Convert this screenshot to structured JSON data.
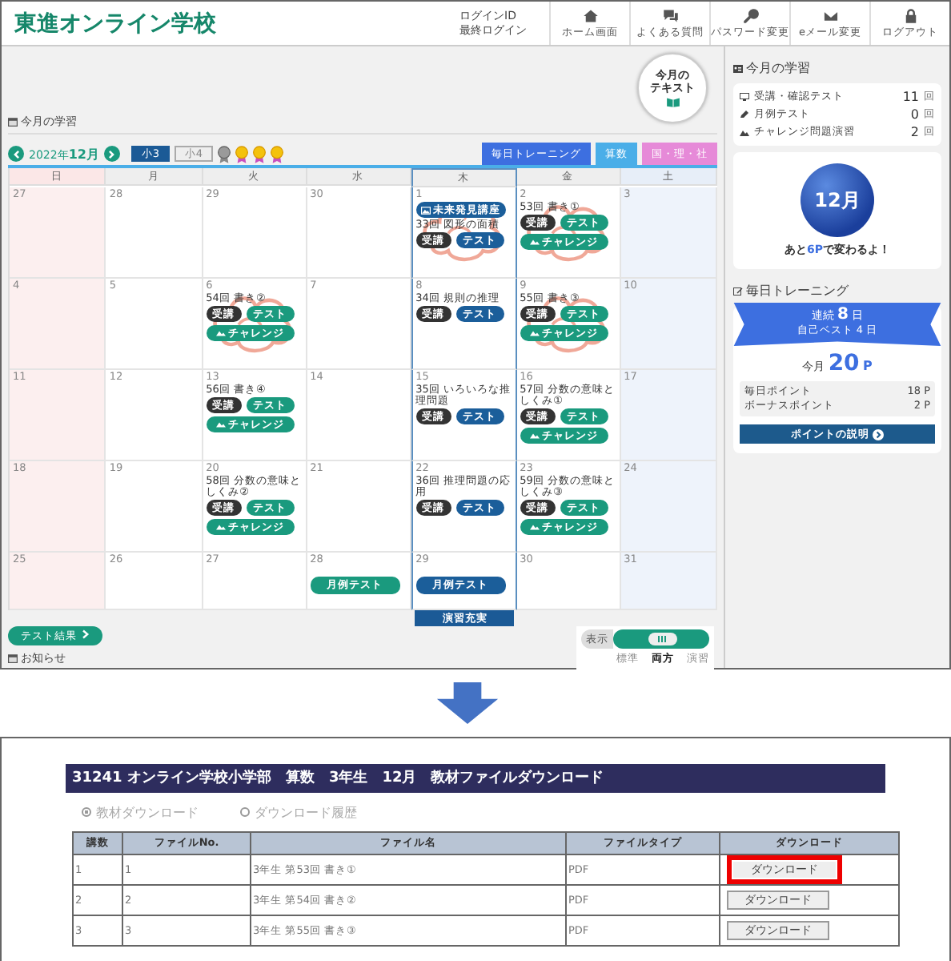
{
  "header": {
    "logo": "東進オンライン学校",
    "login_id_label": "ログインID",
    "last_login_label": "最終ログイン",
    "nav": [
      {
        "kind": "home",
        "label": "ホーム画面"
      },
      {
        "kind": "chat",
        "label": "よくある質問"
      },
      {
        "kind": "key",
        "label": "パスワード変更"
      },
      {
        "kind": "mail",
        "label": "eメール変更"
      },
      {
        "kind": "lock",
        "label": "ログアウト"
      }
    ]
  },
  "text_badge": {
    "lines": [
      "今月の",
      "テキスト"
    ]
  },
  "section_title": "今月の学習",
  "toolbar": {
    "year": "2022年",
    "month": "12月",
    "grades": [
      {
        "label": "小3",
        "selected": true
      },
      {
        "label": "小4",
        "selected": false
      }
    ],
    "medals": [
      {
        "earned": false
      },
      {
        "earned": true
      },
      {
        "earned": true
      },
      {
        "earned": true
      }
    ],
    "tabs": [
      {
        "label": "毎日トレーニング",
        "color": "#3d6fe0"
      },
      {
        "label": "算数",
        "color": "#4aaee8"
      },
      {
        "label": "国・理・社",
        "color": "#e68ad8"
      }
    ]
  },
  "calendar": {
    "weekdays": [
      {
        "label": "日",
        "selected": false
      },
      {
        "label": "月",
        "selected": false
      },
      {
        "label": "火",
        "selected": false
      },
      {
        "label": "水",
        "selected": false
      },
      {
        "label": "木",
        "selected": true
      },
      {
        "label": "金",
        "selected": false
      },
      {
        "label": "土",
        "selected": false
      }
    ],
    "weeks": [
      [
        {
          "day": "27"
        },
        {
          "day": "28"
        },
        {
          "day": "29"
        },
        {
          "day": "30"
        },
        {
          "day": "1",
          "stamp": true,
          "badge": "未来発見講座",
          "title": "33回 図形の面積",
          "kind": "math",
          "buttons": [
            {
              "kind": "lecture",
              "label": "受講"
            },
            {
              "kind": "test",
              "label": "テスト"
            }
          ]
        },
        {
          "day": "2",
          "stamp": true,
          "title": "53回 書き①",
          "kind": "japanese",
          "buttons": [
            {
              "kind": "lecture",
              "label": "受講"
            },
            {
              "kind": "test",
              "label": "テスト"
            },
            {
              "kind": "challenge",
              "label": "チャレンジ"
            }
          ]
        },
        {
          "day": "3"
        }
      ],
      [
        {
          "day": "4"
        },
        {
          "day": "5"
        },
        {
          "day": "6",
          "stamp": true,
          "title": "54回 書き②",
          "kind": "japanese",
          "buttons": [
            {
              "kind": "lecture",
              "label": "受講"
            },
            {
              "kind": "test",
              "label": "テスト"
            },
            {
              "kind": "challenge",
              "label": "チャレンジ"
            }
          ]
        },
        {
          "day": "7"
        },
        {
          "day": "8",
          "title": "34回 規則の推理",
          "kind": "math",
          "buttons": [
            {
              "kind": "lecture",
              "label": "受講"
            },
            {
              "kind": "test",
              "label": "テスト"
            }
          ]
        },
        {
          "day": "9",
          "stamp": true,
          "title": "55回 書き③",
          "kind": "japanese",
          "buttons": [
            {
              "kind": "lecture",
              "label": "受講"
            },
            {
              "kind": "test",
              "label": "テスト"
            },
            {
              "kind": "challenge",
              "label": "チャレンジ"
            }
          ]
        },
        {
          "day": "10"
        }
      ],
      [
        {
          "day": "11"
        },
        {
          "day": "12"
        },
        {
          "day": "13",
          "title": "56回 書き④",
          "kind": "japanese",
          "buttons": [
            {
              "kind": "lecture",
              "label": "受講"
            },
            {
              "kind": "test",
              "label": "テスト"
            },
            {
              "kind": "challenge",
              "label": "チャレンジ"
            }
          ]
        },
        {
          "day": "14"
        },
        {
          "day": "15",
          "title": "35回 いろいろな推理問題",
          "kind": "math",
          "buttons": [
            {
              "kind": "lecture",
              "label": "受講"
            },
            {
              "kind": "test",
              "label": "テスト"
            }
          ]
        },
        {
          "day": "16",
          "title": "57回 分数の意味としくみ①",
          "kind": "japanese",
          "buttons": [
            {
              "kind": "lecture",
              "label": "受講"
            },
            {
              "kind": "test",
              "label": "テスト"
            },
            {
              "kind": "challenge",
              "label": "チャレンジ"
            }
          ]
        },
        {
          "day": "17"
        }
      ],
      [
        {
          "day": "18"
        },
        {
          "day": "19"
        },
        {
          "day": "20",
          "title": "58回 分数の意味としくみ②",
          "kind": "japanese",
          "buttons": [
            {
              "kind": "lecture",
              "label": "受講"
            },
            {
              "kind": "test",
              "label": "テスト"
            },
            {
              "kind": "challenge",
              "label": "チャレンジ"
            }
          ]
        },
        {
          "day": "21"
        },
        {
          "day": "22",
          "title": "36回 推理問題の応用",
          "kind": "math",
          "buttons": [
            {
              "kind": "lecture",
              "label": "受講"
            },
            {
              "kind": "test",
              "label": "テスト"
            }
          ]
        },
        {
          "day": "23",
          "title": "59回 分数の意味としくみ③",
          "kind": "japanese",
          "buttons": [
            {
              "kind": "lecture",
              "label": "受講"
            },
            {
              "kind": "test",
              "label": "テスト"
            },
            {
              "kind": "challenge",
              "label": "チャレンジ"
            }
          ]
        },
        {
          "day": "24"
        }
      ],
      [
        {
          "day": "25"
        },
        {
          "day": "26"
        },
        {
          "day": "27"
        },
        {
          "day": "28",
          "kind": "japanese",
          "buttons": [
            {
              "kind": "monthly",
              "label": "月例テスト"
            }
          ]
        },
        {
          "day": "29",
          "kind": "math",
          "buttons": [
            {
              "kind": "monthly",
              "label": "月例テスト"
            }
          ]
        },
        {
          "day": "30"
        },
        {
          "day": "31"
        }
      ]
    ],
    "column_tab": "演習充実"
  },
  "test_results_button": "テスト結果",
  "notice_title": "お知らせ",
  "view_toggle": {
    "label": "表示",
    "options": [
      {
        "label": "標準",
        "selected": false
      },
      {
        "label": "両方",
        "selected": true
      },
      {
        "label": "演習",
        "selected": false
      }
    ]
  },
  "sidebar": {
    "title": "今月の学習",
    "stats": [
      {
        "kind": "monitor",
        "label": "受講・確認テスト",
        "value": "11",
        "unit": "回"
      },
      {
        "kind": "pencil",
        "label": "月例テスト",
        "value": "0",
        "unit": "回"
      },
      {
        "kind": "mountain",
        "label": "チャレンジ問題演習",
        "value": "2",
        "unit": "回"
      }
    ],
    "month_badge": "12月",
    "message": {
      "before": "あと",
      "highlight": "6P",
      "after": "で変わるよ！"
    },
    "training_title": "毎日トレーニング",
    "streak": {
      "label": "連続",
      "value": "8",
      "unit": "日"
    },
    "best": "自己ベスト 4 日",
    "month_points": {
      "label": "今月",
      "value": "20",
      "unit": "P"
    },
    "points": [
      {
        "label": "毎日ポイント",
        "value": "18 P"
      },
      {
        "label": "ボーナスポイント",
        "value": "2 P"
      }
    ],
    "explain_button": "ポイントの説明"
  },
  "download_page": {
    "title": "31241 オンライン学校小学部　算数　3年生　12月　教材ファイルダウンロード",
    "radios": [
      {
        "label": "教材ダウンロード",
        "selected": true
      },
      {
        "label": "ダウンロード履歴",
        "selected": false
      }
    ],
    "columns": [
      "講数",
      "ファイルNo.",
      "ファイル名",
      "ファイルタイプ",
      "ダウンロード"
    ],
    "rows": [
      {
        "lesson": "1",
        "file_no": "1",
        "file_name": "3年生 第53回 書き①",
        "file_type": "PDF",
        "button": "ダウンロード",
        "highlighted": true
      },
      {
        "lesson": "2",
        "file_no": "2",
        "file_name": "3年生 第54回 書き②",
        "file_type": "PDF",
        "button": "ダウンロード",
        "highlighted": false
      },
      {
        "lesson": "3",
        "file_no": "3",
        "file_name": "3年生 第55回 書き③",
        "file_type": "PDF",
        "button": "ダウンロード",
        "highlighted": false
      }
    ]
  }
}
